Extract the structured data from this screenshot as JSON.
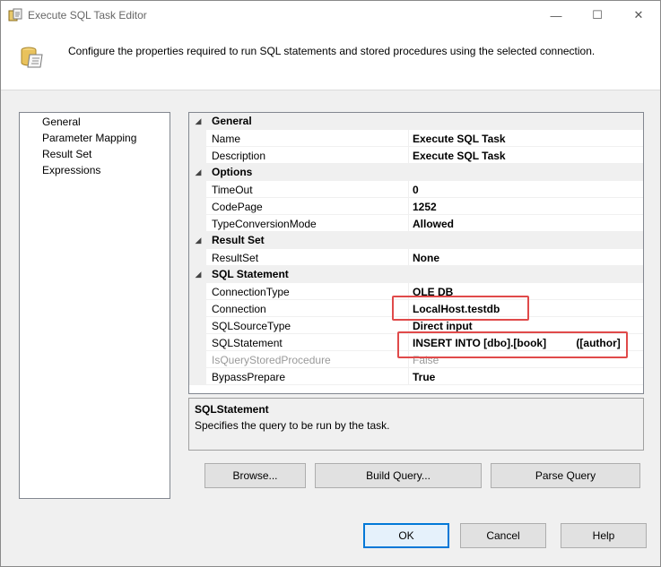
{
  "window": {
    "title": "Execute SQL Task Editor",
    "title_icon": "ssis-task-icon",
    "minimize_glyph": "—",
    "maximize_glyph": "☐",
    "close_glyph": "✕"
  },
  "header": {
    "icon": "sql-task-icon",
    "text": "Configure the properties required to run SQL statements and stored procedures using the selected connection."
  },
  "nav": {
    "items": [
      {
        "label": "General"
      },
      {
        "label": "Parameter Mapping"
      },
      {
        "label": "Result Set"
      },
      {
        "label": "Expressions"
      }
    ]
  },
  "grid": {
    "categories": [
      {
        "label": "General",
        "toggle": "◢",
        "properties": [
          {
            "name": "Name",
            "value": "Execute SQL Task"
          },
          {
            "name": "Description",
            "value": "Execute SQL Task"
          }
        ]
      },
      {
        "label": "Options",
        "toggle": "◢",
        "properties": [
          {
            "name": "TimeOut",
            "value": "0"
          },
          {
            "name": "CodePage",
            "value": "1252"
          },
          {
            "name": "TypeConversionMode",
            "value": "Allowed"
          }
        ]
      },
      {
        "label": "Result Set",
        "toggle": "◢",
        "properties": [
          {
            "name": "ResultSet",
            "value": "None"
          }
        ]
      },
      {
        "label": "SQL Statement",
        "toggle": "◢",
        "properties": [
          {
            "name": "ConnectionType",
            "value": "OLE DB"
          },
          {
            "name": "Connection",
            "value": "LocalHost.testdb"
          },
          {
            "name": "SQLSourceType",
            "value": "Direct input"
          },
          {
            "name": "SQLStatement",
            "value": "INSERT INTO [dbo].[book]          ([author]"
          },
          {
            "name": "IsQueryStoredProcedure",
            "value": "False",
            "disabled": true
          },
          {
            "name": "BypassPrepare",
            "value": "True"
          }
        ]
      }
    ]
  },
  "description": {
    "title": "SQLStatement",
    "text": "Specifies the query to be run by the task."
  },
  "buttons": {
    "browse": "Browse...",
    "build_query": "Build Query...",
    "parse_query": "Parse Query",
    "ok": "OK",
    "cancel": "Cancel",
    "help": "Help"
  },
  "colors": {
    "highlight": "#e04a4a",
    "default_button_border": "#0078d7"
  }
}
